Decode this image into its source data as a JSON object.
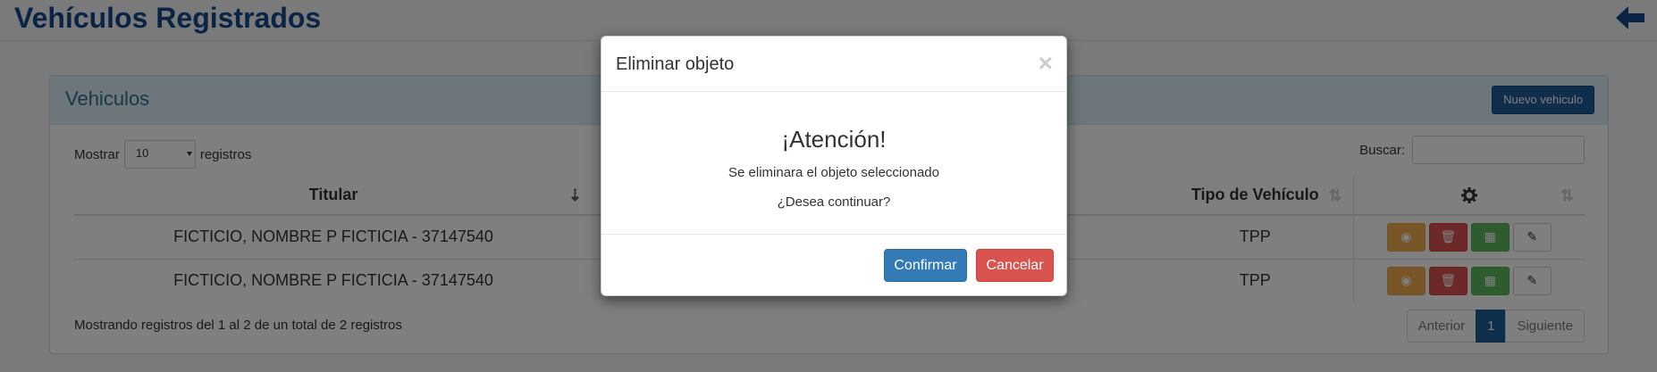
{
  "page": {
    "title": "Vehículos Registrados"
  },
  "panel": {
    "title": "Vehiculos",
    "new_button": "Nuevo vehiculo"
  },
  "table_controls": {
    "show_label": "Mostrar",
    "page_size": "10",
    "records_label": "registros",
    "search_label": "Buscar:",
    "search_value": ""
  },
  "table": {
    "columns": [
      "Titular",
      "",
      "Tipo de Vehículo",
      ""
    ],
    "rows": [
      {
        "titular": "FICTICIO, NOMBRE P FICTICIA - 37147540",
        "tipo": "TPP"
      },
      {
        "titular": "FICTICIO, NOMBRE P FICTICIA - 37147540",
        "tipo": "TPP"
      }
    ],
    "actions": [
      "eye-icon",
      "trash-icon",
      "calendar-icon",
      "pencil-icon"
    ]
  },
  "footer": {
    "info": "Mostrando registros del 1 al 2 de un total de 2 registros",
    "prev": "Anterior",
    "current": "1",
    "next": "Siguiente"
  },
  "modal": {
    "title": "Eliminar objeto",
    "close": "×",
    "heading": "¡Atención!",
    "message": "Se eliminara el objeto seleccionado",
    "question": "¿Desea continuar?",
    "confirm": "Confirmar",
    "cancel": "Cancelar"
  },
  "colors": {
    "brand_blue": "#15498a",
    "primary": "#337ab7",
    "danger": "#d9534f",
    "warning": "#f0ad4e",
    "success": "#5cb85c"
  }
}
